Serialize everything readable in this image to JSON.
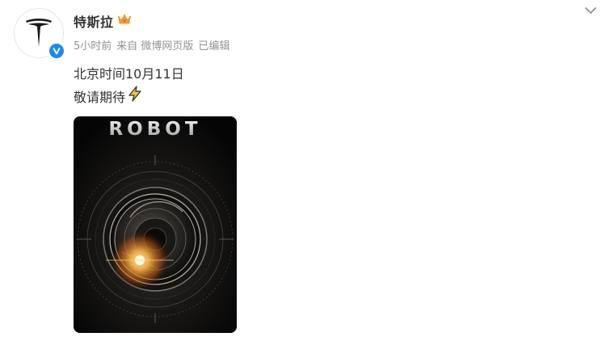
{
  "author": {
    "name": "特斯拉",
    "avatar_icon": "tesla-logo-icon",
    "verified_icon": "verified-badge-icon",
    "badge_icon": "member-crown-icon",
    "verified_color": "#1c8bea"
  },
  "meta": {
    "time": "5小时前",
    "source": "来自 微博网页版",
    "edited": "已编辑"
  },
  "post": {
    "line1": "北京时间10月11日",
    "line2": "敬请期待",
    "line2_emoji": "lightning-icon"
  },
  "media": {
    "title": "ROBOT",
    "image_icon": "camera-lens-icon"
  },
  "controls": {
    "menu_icon": "chevron-down-icon"
  }
}
